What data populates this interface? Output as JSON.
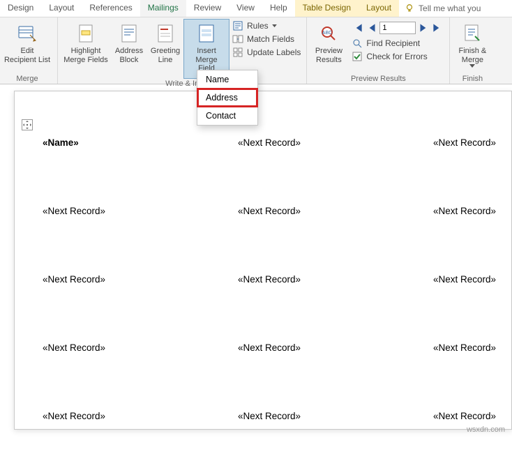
{
  "tabs": {
    "design": "Design",
    "layout": "Layout",
    "references": "References",
    "mailings": "Mailings",
    "review": "Review",
    "view": "View",
    "help": "Help",
    "table_design": "Table Design",
    "table_layout": "Layout",
    "tell_me": "Tell me what you"
  },
  "ribbon": {
    "edit_recip": "Edit\nRecipient List",
    "highlight": "Highlight\nMerge Fields",
    "address_block": "Address\nBlock",
    "greeting": "Greeting\nLine",
    "insert_merge": "Insert Merge\nField",
    "rules": "Rules",
    "match_fields": "Match Fields",
    "update_labels": "Update Labels",
    "preview_results": "Preview\nResults",
    "record_value": "1",
    "find_recipient": "Find Recipient",
    "check_errors": "Check for Errors",
    "finish": "Finish &\nMerge",
    "grp_merge": "Merge",
    "grp_write": "Write & In",
    "grp_preview": "Preview Results",
    "grp_finish": "Finish"
  },
  "dropdown": {
    "name": "Name",
    "address": "Address",
    "contact": "Contact"
  },
  "doc": {
    "field_name": "«Name»",
    "next_record": "«Next Record»"
  },
  "watermark": "wsxdn.com"
}
